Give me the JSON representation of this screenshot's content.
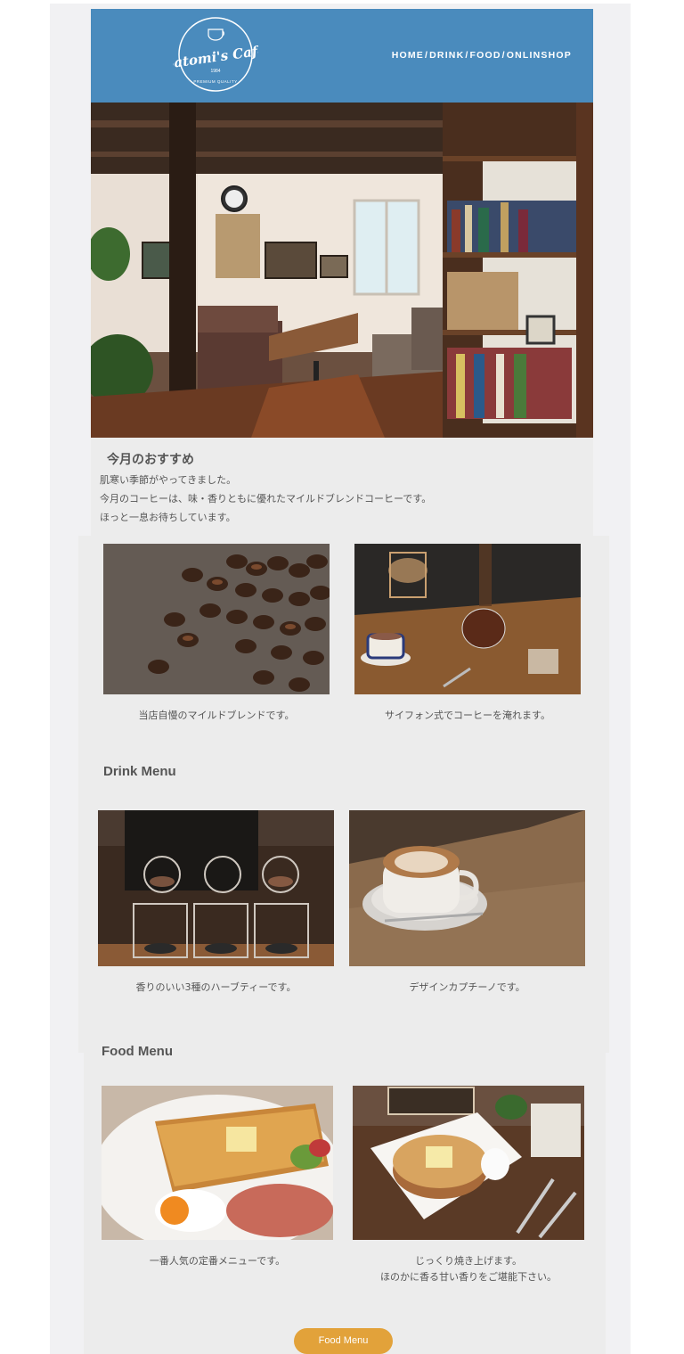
{
  "brand": {
    "name": "Satomi's Cafe",
    "year": "1984",
    "tagline": "PREMIUM QUALITY"
  },
  "nav": {
    "items": [
      "HOME",
      "DRINK",
      "FOOD",
      "ONLINSHOP"
    ],
    "separator": "/"
  },
  "intro": {
    "title": "今月のおすすめ",
    "lines": [
      "肌寒い季節がやってきました。",
      "今月のコーヒーは、味・香りともに優れたマイルドブレンドコーヒーです。",
      "ほっと一息お待ちしています。"
    ]
  },
  "featured": {
    "captions": [
      "当店自慢のマイルドブレンドです。",
      "サイフォン式でコーヒーを淹れます。"
    ]
  },
  "drink": {
    "title": "Drink Menu",
    "captions": [
      "香りのいい3種のハーブティーです。",
      "デザインカプチーノです。"
    ]
  },
  "food": {
    "title": "Food Menu",
    "captions": [
      "一番人気の定番メニューです。",
      "じっくり焼き上げます。",
      "ほのかに香る甘い香りをご堪能下さい。"
    ],
    "button": "Food Menu"
  },
  "colors": {
    "header": "#4a8bbd",
    "button": "#e2a23a",
    "panel": "#ececec"
  }
}
